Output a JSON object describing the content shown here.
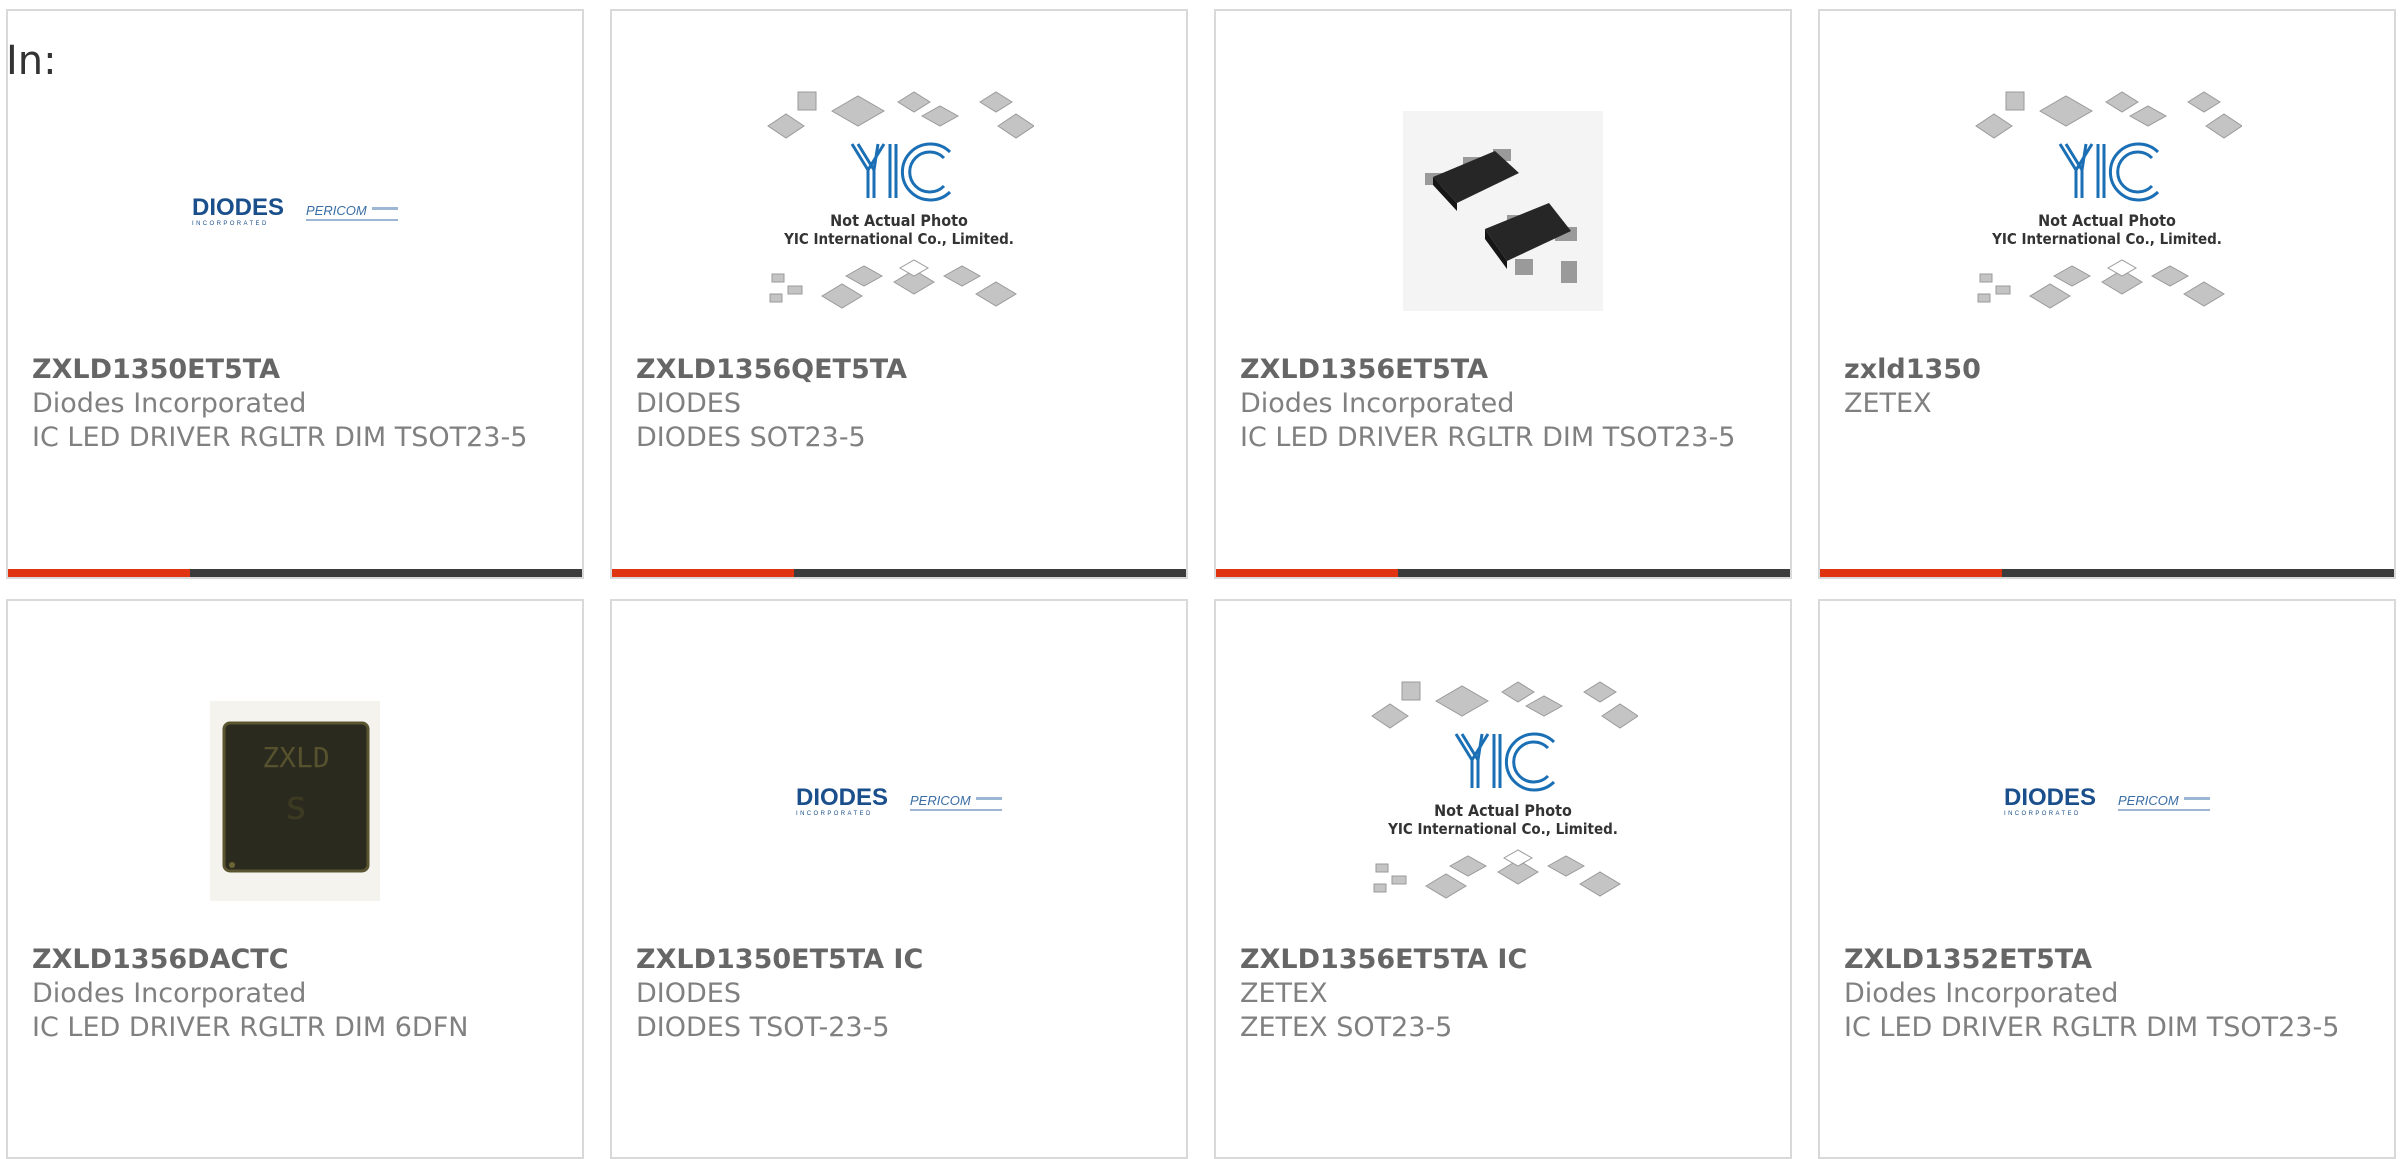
{
  "filter_label": "In:",
  "products": [
    {
      "part": "ZXLD1350ET5TA",
      "manufacturer": "Diodes Incorporated",
      "description": "IC LED DRIVER RGLTR DIM TSOT23-5",
      "image": "diodes-pericom-logo"
    },
    {
      "part": "ZXLD1356QET5TA",
      "manufacturer": "DIODES",
      "description": "DIODES SOT23-5",
      "image": "yic-placeholder"
    },
    {
      "part": "ZXLD1356ET5TA",
      "manufacturer": "Diodes Incorporated",
      "description": "IC LED DRIVER RGLTR DIM TSOT23-5",
      "image": "sot23-chip-photo"
    },
    {
      "part": "zxld1350",
      "manufacturer": "ZETEX",
      "description": "",
      "image": "yic-placeholder"
    },
    {
      "part": "ZXLD1356DACTC",
      "manufacturer": "Diodes Incorporated",
      "description": "IC LED DRIVER RGLTR DIM 6DFN",
      "image": "dfn-chip-photo"
    },
    {
      "part": "ZXLD1350ET5TA IC",
      "manufacturer": "DIODES",
      "description": "DIODES TSOT-23-5",
      "image": "diodes-pericom-logo"
    },
    {
      "part": "ZXLD1356ET5TA IC",
      "manufacturer": "ZETEX",
      "description": "ZETEX SOT23-5",
      "image": "yic-placeholder"
    },
    {
      "part": "ZXLD1352ET5TA",
      "manufacturer": "Diodes Incorporated",
      "description": "IC LED DRIVER RGLTR DIM TSOT23-5",
      "image": "diodes-pericom-logo"
    }
  ],
  "image_text": {
    "diodes_logo": "DIODES",
    "diodes_sub": "INCORPORATED",
    "pericom_logo": "PERICOM",
    "yic_logo": "YIC",
    "yic_line1": "Not Actual Photo",
    "yic_line2": "YIC International Co., Limited.",
    "dfn_marking": "ZXLD"
  },
  "colors": {
    "accent": "#e0330f",
    "bar": "#3c3c3c",
    "card_border": "#d9d9d9",
    "diodes_blue": "#1a4f8b"
  }
}
